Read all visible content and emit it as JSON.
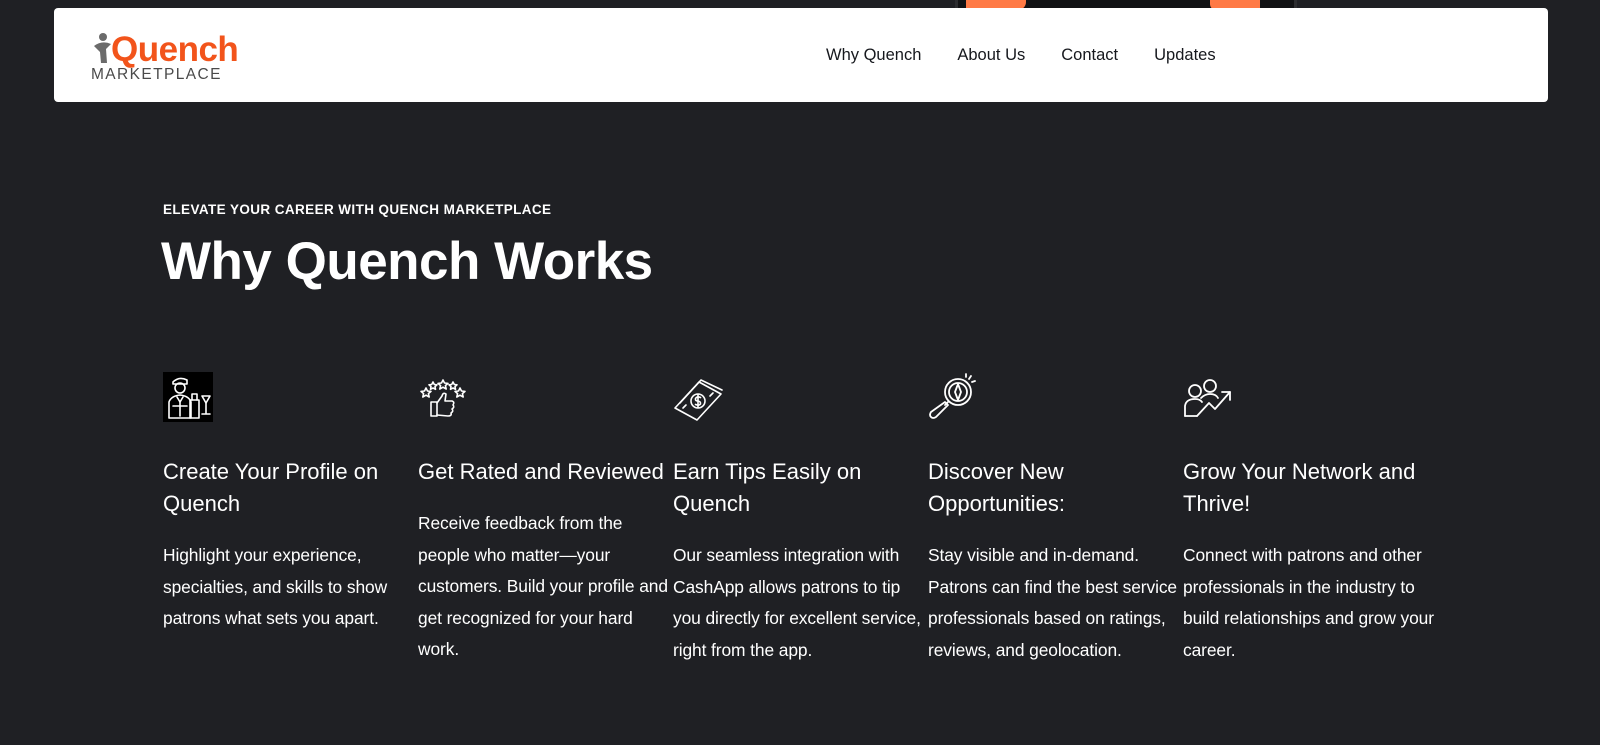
{
  "brand": {
    "name": "Quench",
    "subtitle": "MARKETPLACE",
    "accent_color": "#f2541b",
    "logo_icon": "person-figure-icon"
  },
  "nav": {
    "items": [
      {
        "label": "Why Quench"
      },
      {
        "label": "About Us"
      },
      {
        "label": "Contact"
      },
      {
        "label": "Updates"
      }
    ]
  },
  "section": {
    "eyebrow": "ELEVATE YOUR CAREER WITH QUENCH MARKETPLACE",
    "title": "Why Quench Works",
    "features": [
      {
        "icon": "bartender-icon",
        "title": "Create Your Profile on Quench",
        "description": "Highlight your experience, specialties, and skills to show patrons what sets you apart."
      },
      {
        "icon": "thumbs-up-stars-icon",
        "title": "Get Rated and Reviewed",
        "description": "Receive feedback from the people who matter—your customers. Build your profile and get recognized for your hard work."
      },
      {
        "icon": "money-bill-icon",
        "title": "Earn Tips Easily on Quench",
        "description": "Our seamless integration with CashApp allows patrons to tip you directly for excellent service, right from the app."
      },
      {
        "icon": "magnifier-compass-icon",
        "title": "Discover New Opportunities:",
        "description": "Stay visible and in-demand. Patrons can find the best service professionals based on ratings, reviews, and geolocation."
      },
      {
        "icon": "network-growth-icon",
        "title": "Grow Your Network and Thrive!",
        "description": "Connect with patrons and other professionals in the industry to build relationships and grow your career."
      }
    ]
  }
}
